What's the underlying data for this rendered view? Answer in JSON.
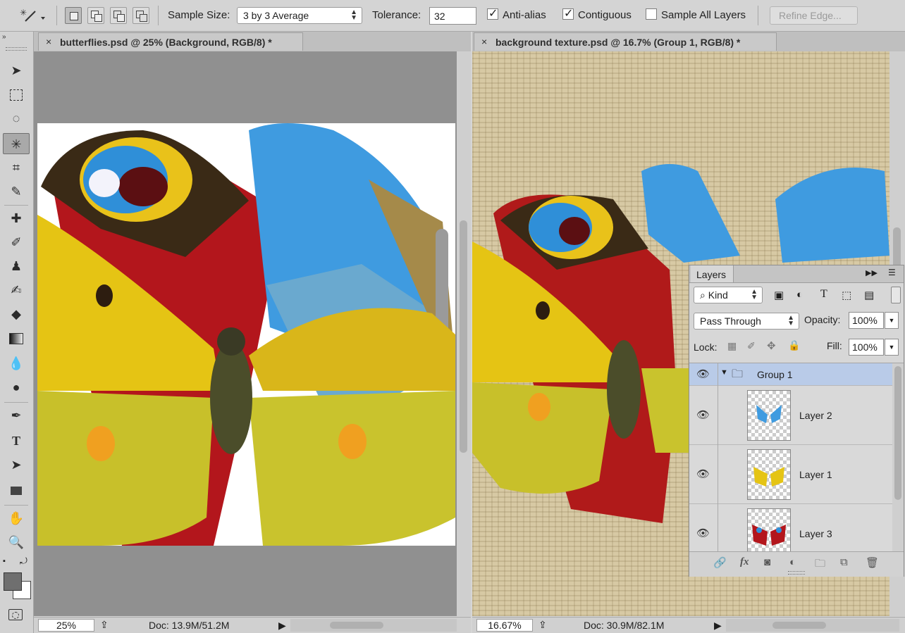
{
  "options_bar": {
    "sample_size_label": "Sample Size:",
    "sample_size_value": "3 by 3 Average",
    "tolerance_label": "Tolerance:",
    "tolerance_value": "32",
    "anti_alias_label": "Anti-alias",
    "anti_alias_checked": true,
    "contiguous_label": "Contiguous",
    "contiguous_checked": true,
    "sample_all_layers_label": "Sample All Layers",
    "sample_all_layers_checked": false,
    "refine_edge_label": "Refine Edge..."
  },
  "toolbar": {
    "active_tool": "magic-wand",
    "tools": [
      "move",
      "marquee",
      "lasso",
      "magic-wand",
      "crop",
      "eyedropper",
      "healing",
      "brush",
      "stamp",
      "history-brush",
      "eraser",
      "gradient",
      "blur",
      "dodge",
      "pen",
      "type",
      "path-select",
      "rectangle",
      "hand",
      "zoom"
    ]
  },
  "doc_left": {
    "tab_title": "butterflies.psd @ 25% (Background, RGB/8) *",
    "close_glyph": "×",
    "zoom": "25%",
    "doc_info": "Doc: 13.9M/51.2M"
  },
  "doc_right": {
    "tab_title": "background texture.psd @ 16.7% (Group 1, RGB/8) *",
    "close_glyph": "×",
    "zoom": "16.67%",
    "doc_info": "Doc: 30.9M/82.1M"
  },
  "layers_panel": {
    "title": "Layers",
    "filter_kind": "Kind",
    "blend_mode": "Pass Through",
    "opacity_label": "Opacity:",
    "opacity_value": "100%",
    "lock_label": "Lock:",
    "fill_label": "Fill:",
    "fill_value": "100%",
    "group_name": "Group 1",
    "layers": [
      {
        "name": "Layer 2"
      },
      {
        "name": "Layer 1"
      },
      {
        "name": "Layer 3"
      }
    ],
    "footer_fx": "fx"
  },
  "colors": {
    "ui_gray": "#d6d6d6",
    "selected_row": "#b8c9e6",
    "canvas_bg": "#909090"
  }
}
